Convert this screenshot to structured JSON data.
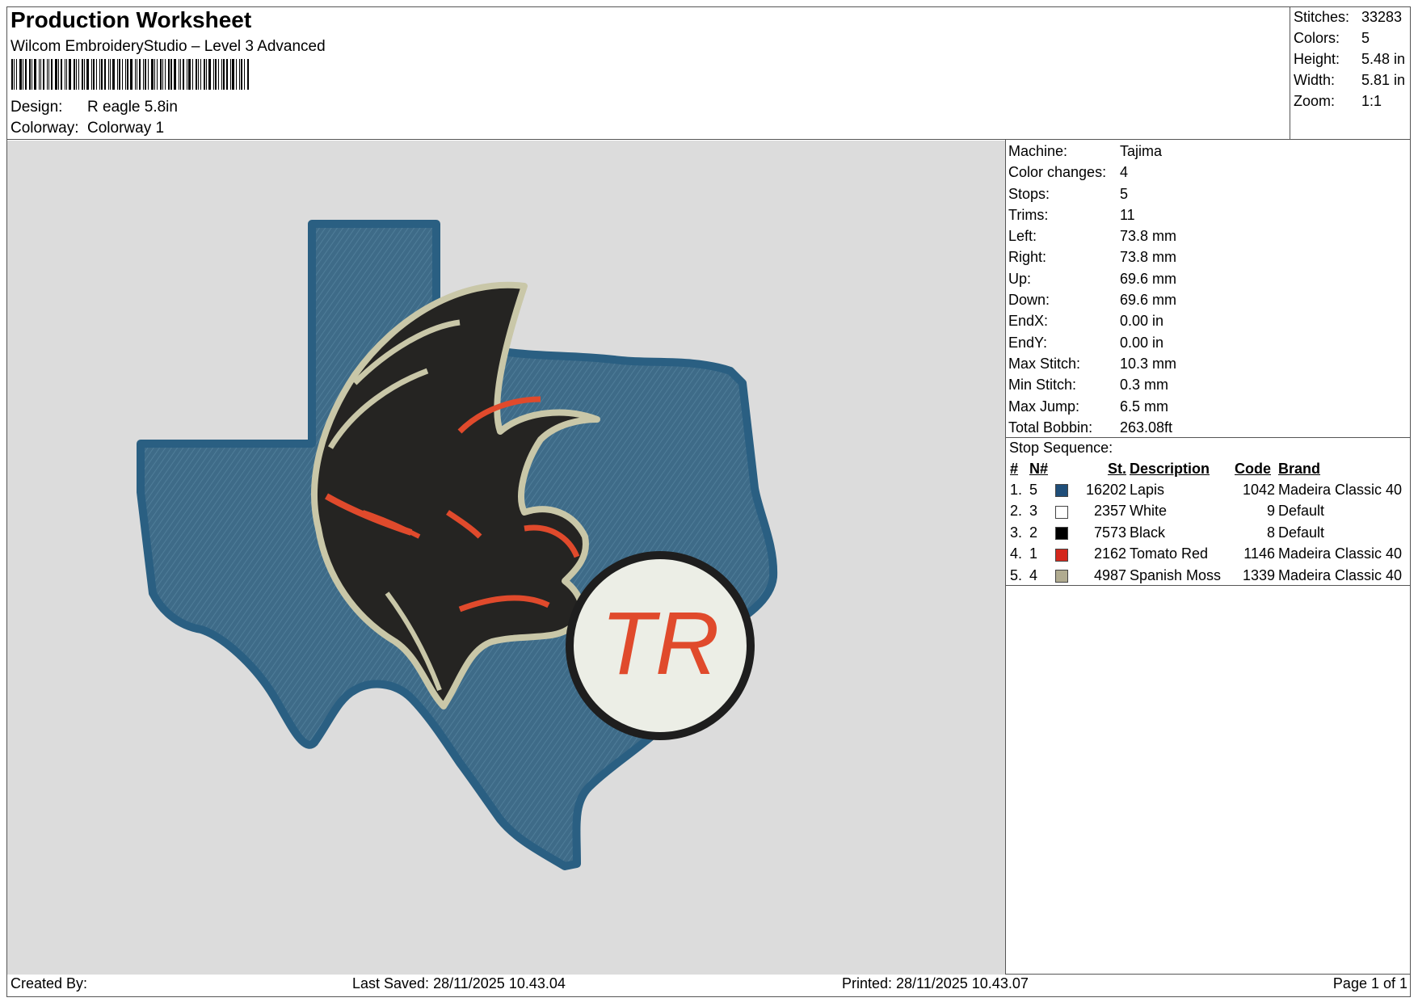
{
  "header": {
    "title": "Production Worksheet",
    "software": "Wilcom EmbroideryStudio – Level 3 Advanced",
    "design_label": "Design:",
    "design_value": "R eagle 5.8in",
    "colorway_label": "Colorway:",
    "colorway_value": "Colorway 1"
  },
  "stats": [
    {
      "k": "Stitches:",
      "v": "33283"
    },
    {
      "k": "Colors:",
      "v": "5"
    },
    {
      "k": "Height:",
      "v": "5.48 in"
    },
    {
      "k": "Width:",
      "v": "5.81 in"
    },
    {
      "k": "Zoom:",
      "v": "1:1"
    }
  ],
  "machine_info": [
    {
      "k": "Machine:",
      "v": "Tajima"
    },
    {
      "k": "Color changes:",
      "v": "4"
    },
    {
      "k": "Stops:",
      "v": "5"
    },
    {
      "k": "Trims:",
      "v": "11"
    },
    {
      "k": "Left:",
      "v": "73.8 mm"
    },
    {
      "k": "Right:",
      "v": "73.8 mm"
    },
    {
      "k": "Up:",
      "v": "69.6 mm"
    },
    {
      "k": "Down:",
      "v": "69.6 mm"
    },
    {
      "k": "EndX:",
      "v": "0.00 in"
    },
    {
      "k": "EndY:",
      "v": "0.00 in"
    },
    {
      "k": "Max Stitch:",
      "v": "10.3 mm"
    },
    {
      "k": "Min Stitch:",
      "v": "0.3 mm"
    },
    {
      "k": "Max Jump:",
      "v": "6.5 mm"
    },
    {
      "k": "Total Bobbin:",
      "v": "263.08ft"
    }
  ],
  "stop_sequence": {
    "title": "Stop Sequence:",
    "headers": {
      "num": "#",
      "n": "N#",
      "st": "St.",
      "desc": "Description",
      "code": "Code",
      "brand": "Brand"
    },
    "rows": [
      {
        "num": "1.",
        "n": "5",
        "color": "#1f4e79",
        "st": "16202",
        "desc": "Lapis",
        "code": "1042",
        "brand": "Madeira Classic 40"
      },
      {
        "num": "2.",
        "n": "3",
        "color": "#ffffff",
        "st": "2357",
        "desc": "White",
        "code": "9",
        "brand": "Default"
      },
      {
        "num": "3.",
        "n": "2",
        "color": "#000000",
        "st": "7573",
        "desc": "Black",
        "code": "8",
        "brand": "Default"
      },
      {
        "num": "4.",
        "n": "1",
        "color": "#d4271c",
        "st": "2162",
        "desc": "Tomato Red",
        "code": "1146",
        "brand": "Madeira Classic 40"
      },
      {
        "num": "5.",
        "n": "4",
        "color": "#b0ab90",
        "st": "4987",
        "desc": "Spanish Moss",
        "code": "1339",
        "brand": "Madeira Classic 40"
      }
    ]
  },
  "design_art": {
    "monogram": "TR",
    "colors": {
      "state": "#3d6a86",
      "state_outline": "#2a5f82",
      "eagle_body": "#252422",
      "eagle_outline": "#c9c7a8",
      "accent": "#e04a2c",
      "circle_fill": "#eceee6",
      "circle_ring": "#1e1e1e"
    }
  },
  "footer": {
    "created_by": "Created By:",
    "last_saved": "Last Saved: 28/11/2025 10.43.04",
    "printed": "Printed: 28/11/2025 10.43.07",
    "page": "Page 1 of 1"
  }
}
